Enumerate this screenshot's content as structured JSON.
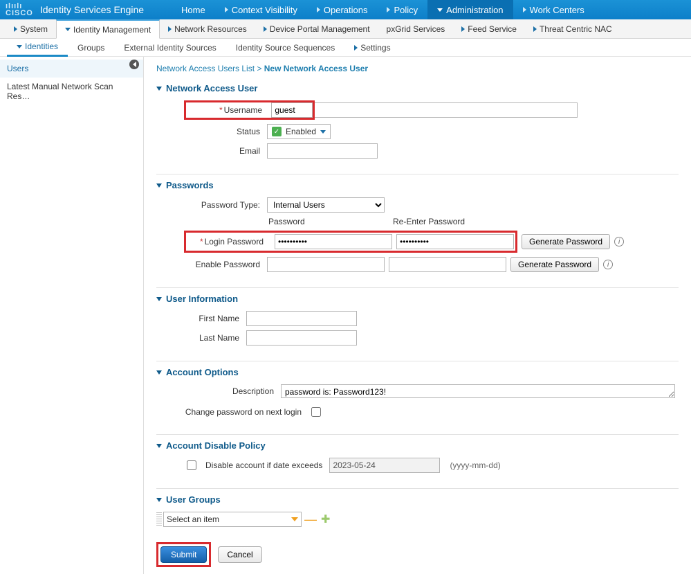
{
  "header": {
    "logo_small": "ılıılı",
    "logo_text": "CISCO",
    "product": "Identity Services Engine",
    "tabs": [
      "Home",
      "Context Visibility",
      "Operations",
      "Policy",
      "Administration",
      "Work Centers"
    ],
    "active": "Administration"
  },
  "subnav": {
    "items": [
      "System",
      "Identity Management",
      "Network Resources",
      "Device Portal Management",
      "pxGrid Services",
      "Feed Service",
      "Threat Centric NAC"
    ],
    "active": "Identity Management"
  },
  "subnav2": {
    "items": [
      "Identities",
      "Groups",
      "External Identity Sources",
      "Identity Source Sequences",
      "Settings"
    ],
    "active": "Identities"
  },
  "sidebar": {
    "items": [
      "Users",
      "Latest Manual Network Scan Res…"
    ],
    "selected": "Users"
  },
  "breadcrumb": {
    "list": "Network Access Users List",
    "sep": ">",
    "current": "New Network Access User"
  },
  "sections": {
    "user": {
      "title": "Network Access User",
      "username_label": "Username",
      "username_value": "guest",
      "status_label": "Status",
      "status_value": "Enabled",
      "email_label": "Email",
      "email_value": ""
    },
    "passwords": {
      "title": "Passwords",
      "type_label": "Password Type:",
      "type_value": "Internal Users",
      "col_password": "Password",
      "col_reenter": "Re-Enter Password",
      "login_label": "Login Password",
      "login_value": "••••••••••",
      "login_re_value": "••••••••••",
      "enable_label": "Enable Password",
      "enable_value": "",
      "enable_re_value": "",
      "gen_label": "Generate Password"
    },
    "info": {
      "title": "User Information",
      "first_label": "First Name",
      "first_value": "",
      "last_label": "Last Name",
      "last_value": ""
    },
    "options": {
      "title": "Account Options",
      "desc_label": "Description",
      "desc_value": "password is: Password123!",
      "change_pw_label": "Change password on next login"
    },
    "disable": {
      "title": "Account Disable Policy",
      "check_label": "Disable account if date exceeds",
      "date_value": "2023-05-24",
      "date_hint": "(yyyy-mm-dd)"
    },
    "groups": {
      "title": "User Groups",
      "select_placeholder": "Select an item"
    }
  },
  "actions": {
    "submit": "Submit",
    "cancel": "Cancel"
  }
}
